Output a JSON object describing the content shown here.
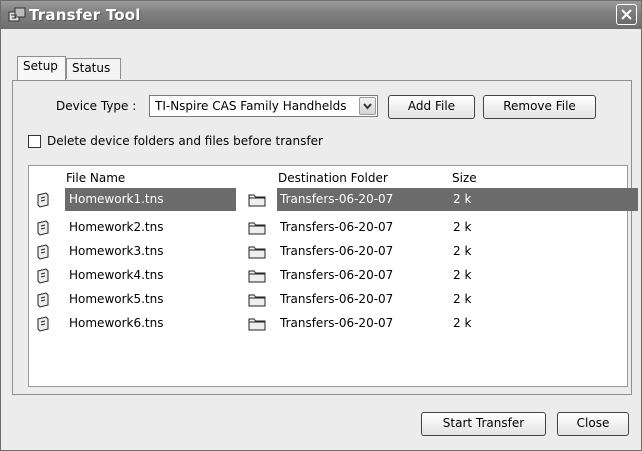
{
  "window": {
    "title": "Transfer Tool"
  },
  "tabs": [
    {
      "label": "Setup",
      "active": true
    },
    {
      "label": "Status",
      "active": false
    }
  ],
  "device": {
    "label": "Device Type :",
    "selected": "TI-Nspire CAS Family Handhelds"
  },
  "buttons": {
    "add_file": "Add File",
    "remove_file": "Remove File",
    "start_transfer": "Start Transfer",
    "close": "Close"
  },
  "delete_option": {
    "label": "Delete device folders and files before transfer",
    "checked": false
  },
  "table": {
    "columns": [
      "File Name",
      "Destination Folder",
      "Size"
    ],
    "rows": [
      {
        "file": "Homework1.tns",
        "folder": "Transfers-06-20-07",
        "size": "2 k",
        "selected": true
      },
      {
        "file": "Homework2.tns",
        "folder": "Transfers-06-20-07",
        "size": "2 k",
        "selected": false
      },
      {
        "file": "Homework3.tns",
        "folder": "Transfers-06-20-07",
        "size": "2 k",
        "selected": false
      },
      {
        "file": "Homework4.tns",
        "folder": "Transfers-06-20-07",
        "size": "2 k",
        "selected": false
      },
      {
        "file": "Homework5.tns",
        "folder": "Transfers-06-20-07",
        "size": "2 k",
        "selected": false
      },
      {
        "file": "Homework6.tns",
        "folder": "Transfers-06-20-07",
        "size": "2 k",
        "selected": false
      }
    ]
  },
  "icons": {
    "title": "transfer-tool-icon",
    "file": "tns-document-icon",
    "folder": "folder-icon",
    "dropdown": "chevron-down-icon",
    "close": "close-icon"
  },
  "colors": {
    "titlebar": "#7e7e7e",
    "selection": "#6b6b6b",
    "background": "#ececec"
  }
}
